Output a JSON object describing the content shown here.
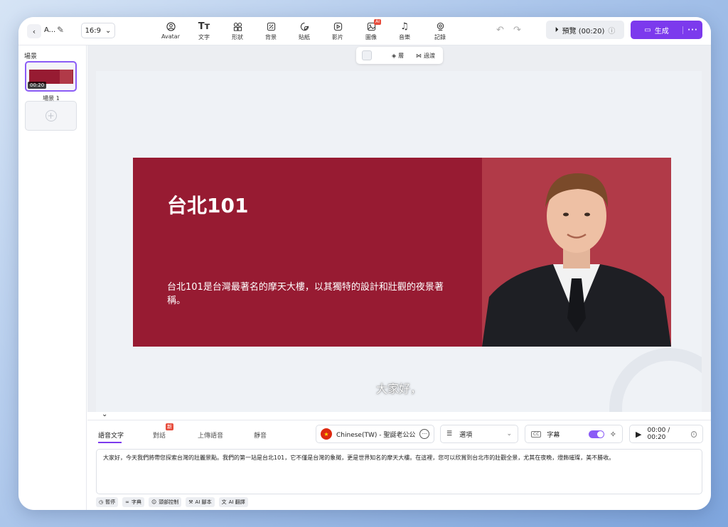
{
  "toolbar": {
    "project_name": "A...",
    "aspect_ratio": "16:9",
    "tools": [
      {
        "label": "Avatar",
        "icon": "avatar-icon"
      },
      {
        "label": "文字",
        "icon": "text-icon"
      },
      {
        "label": "形狀",
        "icon": "shapes-icon"
      },
      {
        "label": "背景",
        "icon": "background-icon"
      },
      {
        "label": "貼紙",
        "icon": "sticker-icon"
      },
      {
        "label": "影片",
        "icon": "video-icon"
      },
      {
        "label": "圖像",
        "icon": "image-icon",
        "badge": "AI"
      },
      {
        "label": "音樂",
        "icon": "music-icon"
      },
      {
        "label": "記錄",
        "icon": "record-icon"
      }
    ],
    "preview_label": "預覽 (00:20)",
    "generate_label": "生成"
  },
  "sidebar": {
    "title": "場景",
    "scenes": [
      {
        "label": "場景 1",
        "duration": "00:20"
      }
    ]
  },
  "float_bar": {
    "layer_label": "層",
    "transition_label": "過渡"
  },
  "slide": {
    "title": "台北101",
    "description": "台北101是台灣最著名的摩天大樓，以其獨特的設計和壯觀的夜景著稱。",
    "subtitle": "大家好，"
  },
  "bottom": {
    "tabs": [
      {
        "label": "語音文字",
        "active": true
      },
      {
        "label": "對話",
        "badge": "新"
      },
      {
        "label": "上傳語音"
      },
      {
        "label": "靜音"
      }
    ],
    "voice": "Chinese(TW) - 聖誕老公公",
    "options_label": "選項",
    "subtitles_label": "字幕",
    "cc_label": "CC",
    "time": "00:00 / 00:20",
    "script_text": "大家好，今天我們將帶您探索台灣的壯麗景點。我們的第一站是台北101，它不僅是台灣的象徵，更是世界知名的摩天大樓。在這裡，您可以欣賞到台北市的壯觀全景，尤其在夜晚，燈飾璀璨，美不勝收。",
    "mini_tools": [
      "暫停",
      "字典",
      "頭部控制",
      "AI 腳本",
      "AI 翻譯"
    ]
  },
  "colors": {
    "accent": "#7c3aed",
    "slide_bg": "#971b32",
    "presenter_bg": "#b13a48"
  }
}
